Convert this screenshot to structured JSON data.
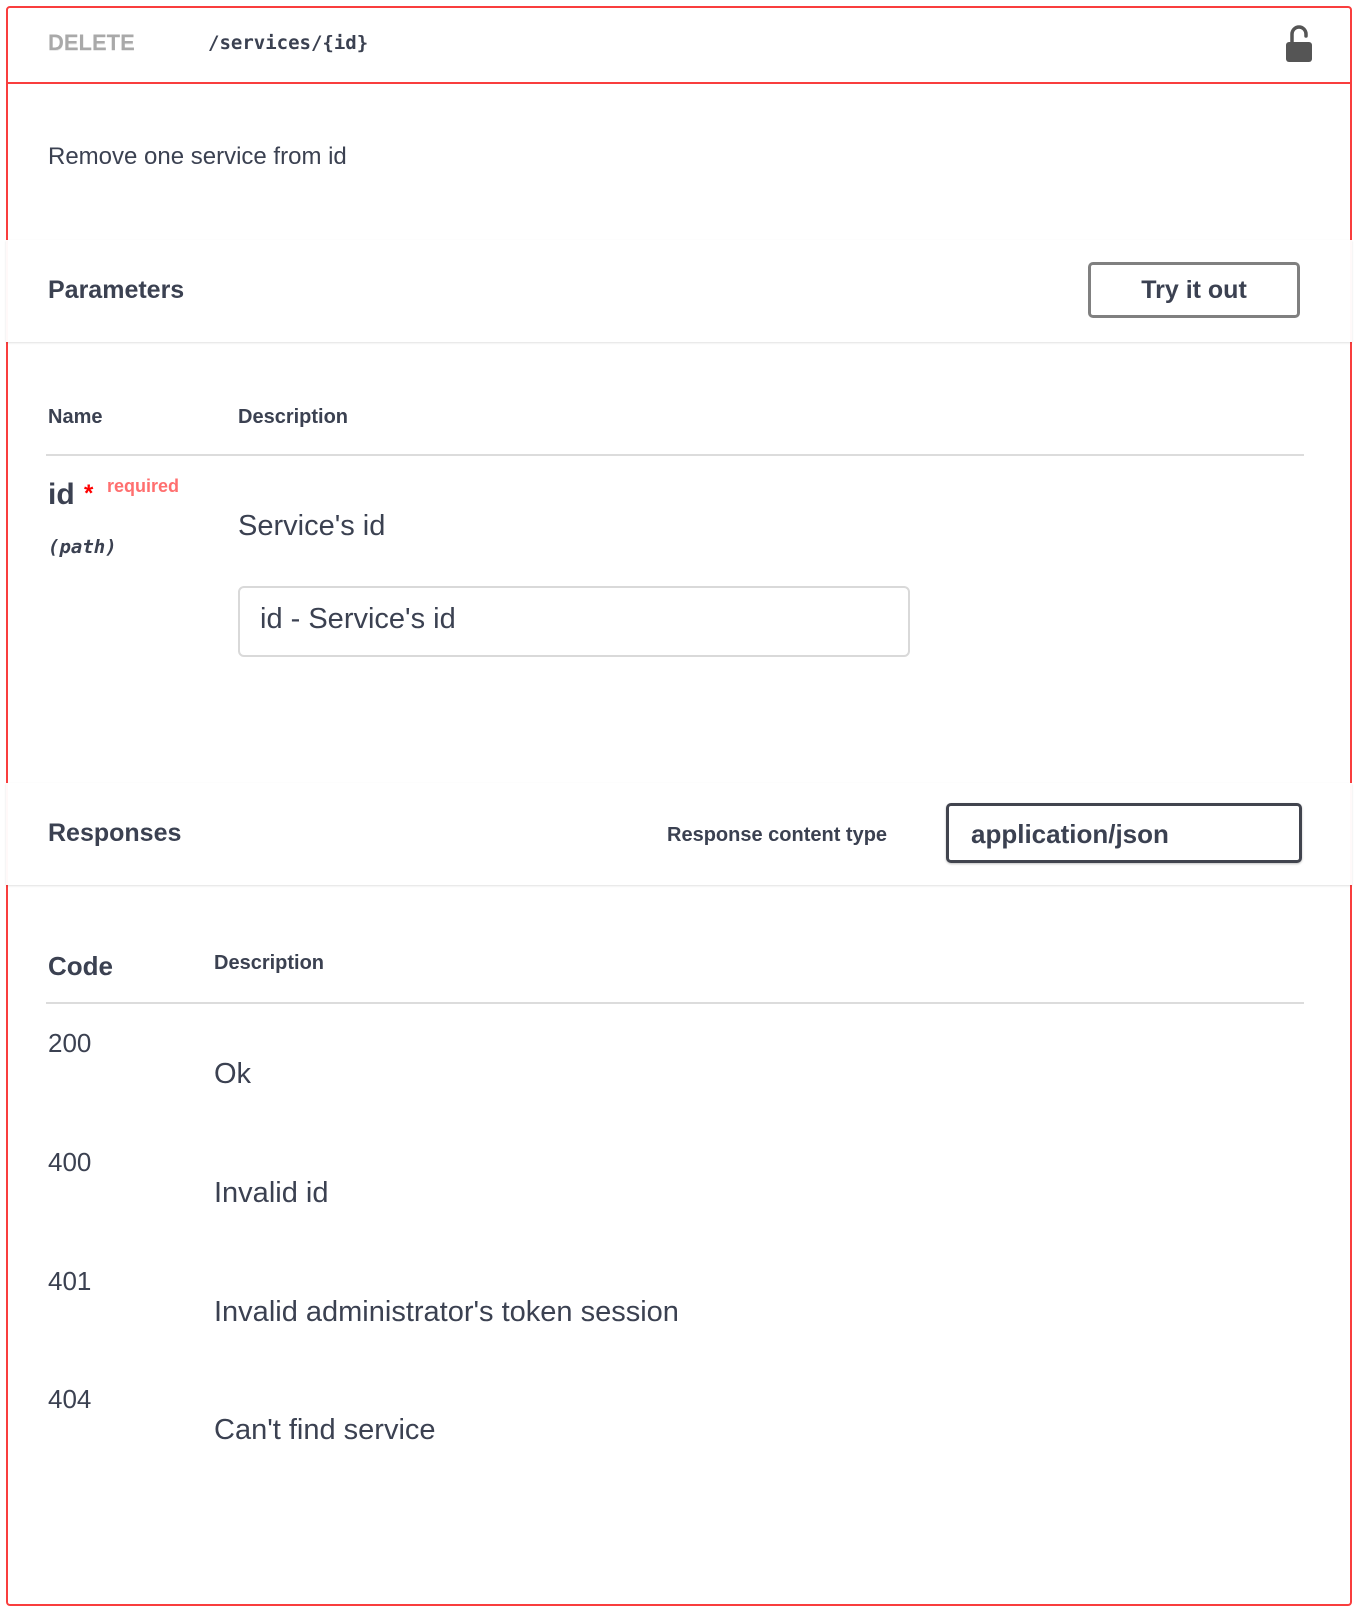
{
  "operation": {
    "method": "DELETE",
    "path": "/services/{id}",
    "description": "Remove one service from id",
    "lock_icon": "unlocked-padlock-icon",
    "accent_color": "#f93e3e"
  },
  "parameters": {
    "title": "Parameters",
    "try_button": "Try it out",
    "col_name": "Name",
    "col_description": "Description",
    "items": [
      {
        "name": "id",
        "required_star": "*",
        "required_label": "required",
        "in": "(path)",
        "description": "Service's id",
        "input_placeholder": "id - Service's id"
      }
    ]
  },
  "responses": {
    "title": "Responses",
    "content_type_label": "Response content type",
    "content_type_value": "application/json",
    "col_code": "Code",
    "col_description": "Description",
    "rows": [
      {
        "code": "200",
        "description": "Ok"
      },
      {
        "code": "400",
        "description": "Invalid id"
      },
      {
        "code": "401",
        "description": "Invalid administrator's token session"
      },
      {
        "code": "404",
        "description": "Can't find service"
      }
    ]
  }
}
